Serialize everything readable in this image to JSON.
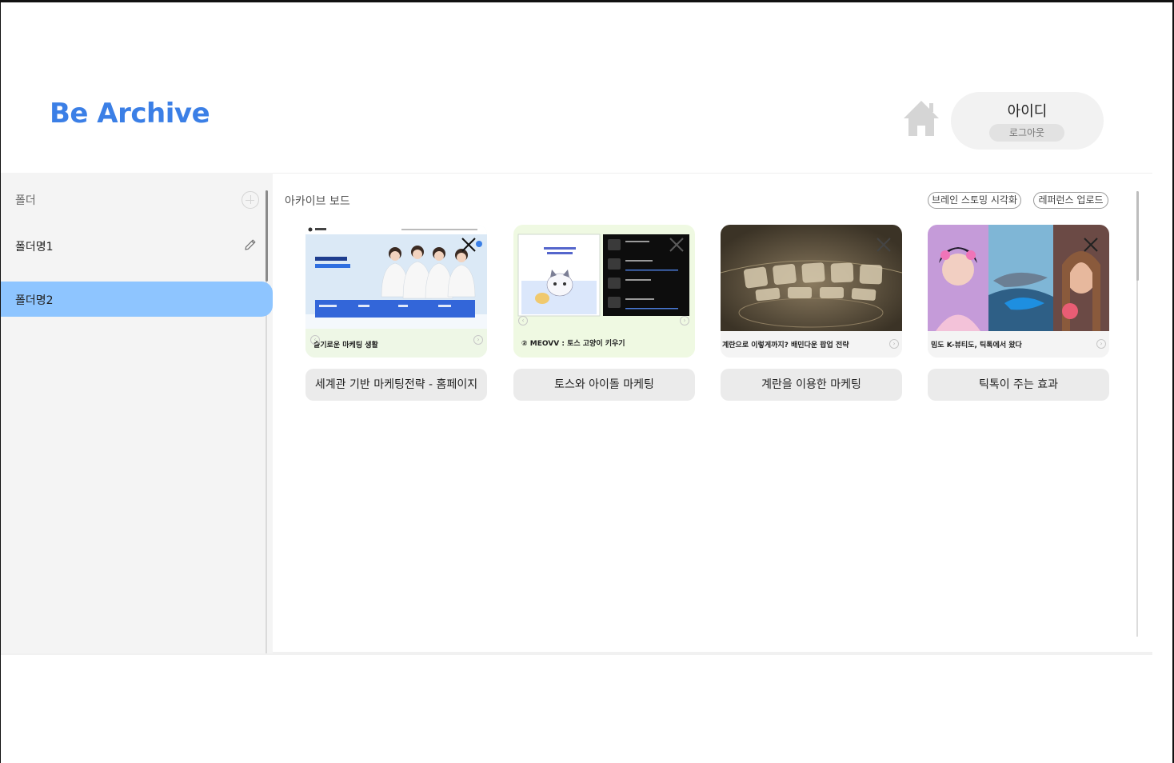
{
  "header": {
    "logo_text": "Be Archive",
    "home_icon": "home-icon",
    "user": {
      "name": "아이디",
      "logout_label": "로그아웃"
    }
  },
  "sidebar": {
    "title": "폴더",
    "add_icon": "plus-circle-icon",
    "folders": [
      {
        "label": "폴더명1",
        "selected": false,
        "edit_icon": "pencil-icon"
      },
      {
        "label": "폴더명2",
        "selected": true
      }
    ],
    "selected_color": "#8ec5ff"
  },
  "board": {
    "title": "아카이브 보드",
    "actions": {
      "brainstorm_label": "브레인 스토밍 시각화",
      "upload_label": "레퍼런스 업로드"
    },
    "cards": [
      {
        "title": "세계관 기반 마케팅전략 -  홈페이지",
        "thumbnail_caption": "슬기로운 마케팅 생활",
        "thumbnail_heading": "빼돌과 열정으로 성장하는 홈페인",
        "close_icon": "close-icon"
      },
      {
        "title": "토스와 아이돌 마케팅",
        "thumbnail_caption": "② MEOVV : 토스 고양이 키우기",
        "close_icon": "close-icon"
      },
      {
        "title": "계란을 이용한 마케팅",
        "thumbnail_caption": "계란으로 이렇게까지? 배민다운 팝업 전략",
        "close_icon": "close-icon"
      },
      {
        "title": "틱톡이 주는 효과",
        "thumbnail_caption": "밈도 K-뷰티도, 틱톡에서 왔다",
        "close_icon": "close-icon"
      }
    ]
  },
  "colors": {
    "brand": "#3b7fe6",
    "selected_folder": "#8ec5ff"
  }
}
